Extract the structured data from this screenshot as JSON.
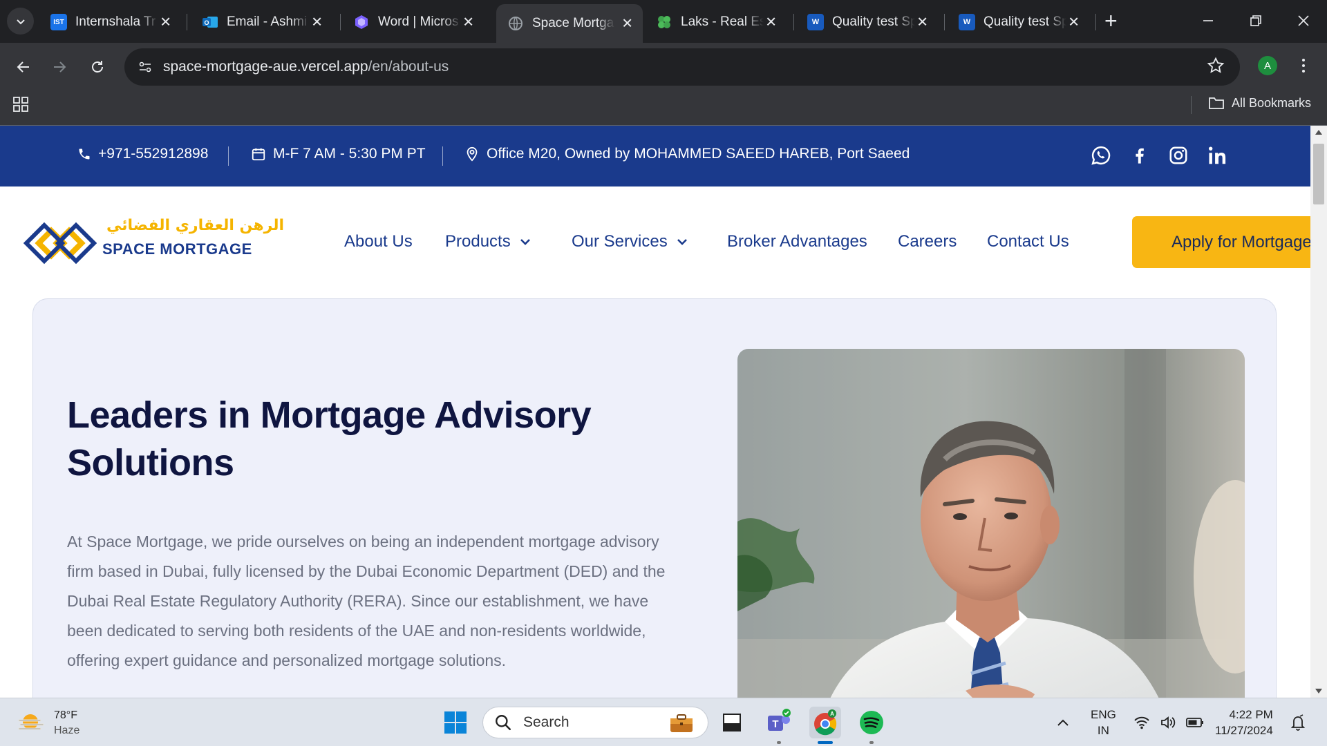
{
  "browser": {
    "tabs": [
      {
        "title": "Internshala Tr",
        "favicon": "IST",
        "favicon_color": "#1a73e8"
      },
      {
        "title": "Email - Ashmi",
        "favicon": "outlook-icon",
        "favicon_color": "#0f6cbd"
      },
      {
        "title": "Word | Micros",
        "favicon": "copilot-icon",
        "favicon_color": "#7b61ff"
      },
      {
        "title": "Space Mortga",
        "favicon": "globe-icon",
        "favicon_color": "#9aa0a6",
        "active": true
      },
      {
        "title": "Laks - Real Est",
        "favicon": "clover-icon",
        "favicon_color": "#3fa34d"
      },
      {
        "title": "Quality test Sp",
        "favicon": "W",
        "favicon_color": "#185abd"
      },
      {
        "title": "Quality test Sp",
        "favicon": "W",
        "favicon_color": "#185abd"
      }
    ],
    "url_domain": "space-mortgage-aue.vercel.app",
    "url_path": "/en/about-us",
    "profile_initial": "A",
    "all_bookmarks_label": "All Bookmarks"
  },
  "topbar": {
    "phone": "+971-552912898",
    "hours": "M-F 7 AM - 5:30 PM PT",
    "address": "Office M20, Owned by MOHAMMED SAEED HAREB, Port Saeed",
    "background_color": "#1a3a8c"
  },
  "logo": {
    "arabic_text": "الرهن العقاري الفضائي",
    "english_text": "SPACE MORTGAGE"
  },
  "nav": {
    "about": "About Us",
    "products": "Products",
    "services": "Our Services",
    "broker": "Broker Advantages",
    "careers": "Careers",
    "contact": "Contact Us",
    "apply": "Apply for Mortgage",
    "accent_color": "#f8b613",
    "link_color": "#1a3a8c"
  },
  "hero": {
    "title": "Leaders in Mortgage Advisory Solutions",
    "body": "At Space Mortgage, we pride ourselves on being an independent mortgage advisory firm based in Dubai, fully licensed by the Dubai Economic Department (DED) and the Dubai Real Estate Regulatory Authority (RERA). Since our establishment, we have been dedicated to serving both residents of the UAE and non-residents worldwide, offering expert guidance and personalized mortgage solutions.",
    "background_color": "#eef0fa"
  },
  "taskbar": {
    "weather_temp": "78°F",
    "weather_cond": "Haze",
    "search_label": "Search",
    "lang_line1": "ENG",
    "lang_line2": "IN",
    "time": "4:22 PM",
    "date": "11/27/2024"
  }
}
